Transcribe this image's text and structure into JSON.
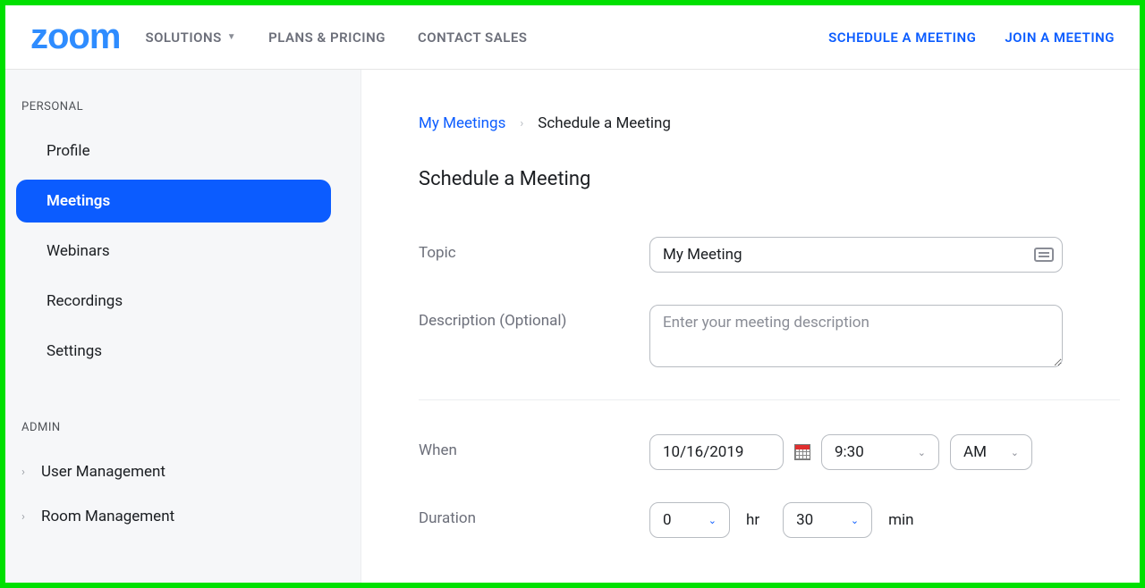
{
  "header": {
    "logo": "zoom",
    "nav": {
      "solutions": "SOLUTIONS",
      "plans": "PLANS & PRICING",
      "contact": "CONTACT SALES"
    },
    "right": {
      "schedule": "SCHEDULE A MEETING",
      "join": "JOIN A MEETING"
    }
  },
  "sidebar": {
    "personal_label": "PERSONAL",
    "items": {
      "profile": "Profile",
      "meetings": "Meetings",
      "webinars": "Webinars",
      "recordings": "Recordings",
      "settings": "Settings"
    },
    "admin_label": "ADMIN",
    "admin_items": {
      "user_management": "User Management",
      "room_management": "Room Management"
    }
  },
  "breadcrumb": {
    "link": "My Meetings",
    "current": "Schedule a Meeting"
  },
  "page": {
    "title": "Schedule a Meeting"
  },
  "form": {
    "topic": {
      "label": "Topic",
      "value": "My Meeting"
    },
    "description": {
      "label": "Description (Optional)",
      "placeholder": "Enter your meeting description"
    },
    "when": {
      "label": "When",
      "date": "10/16/2019",
      "time": "9:30",
      "ampm": "AM"
    },
    "duration": {
      "label": "Duration",
      "hours": "0",
      "hr_unit": "hr",
      "minutes": "30",
      "min_unit": "min"
    }
  }
}
